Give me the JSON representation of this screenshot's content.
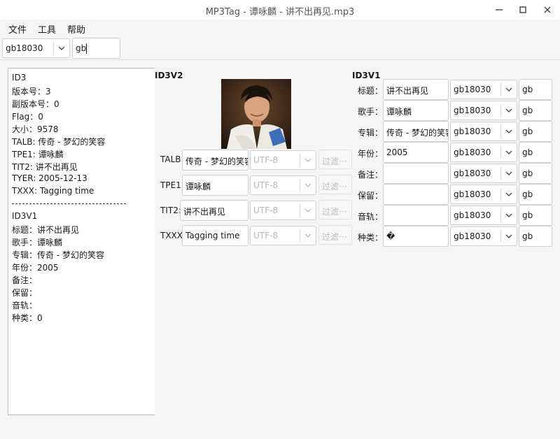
{
  "window": {
    "title": "MP3Tag - 谭咏麟 - 讲不出再见.mp3"
  },
  "menu": [
    "文件",
    "工具",
    "帮助"
  ],
  "toolbar": {
    "encoding": "gb18030",
    "filter": "gb"
  },
  "info": {
    "lines_top": [
      "ID3",
      "版本号：3",
      "副版本号：0",
      "Flag：0",
      "大小：9578",
      "TALB: 传奇 - 梦幻的笑容",
      "TPE1: 谭咏麟",
      "TIT2: 讲不出再见",
      "TYER: 2005-12-13",
      "TXXX: Tagging time"
    ],
    "separator": "----------------------------------------",
    "lines_bottom": [
      "ID3V1",
      "标题：讲不出再见",
      "歌手：谭咏麟",
      "专辑：传奇 - 梦幻的笑容",
      "年份：2005",
      "备注：",
      "保留：",
      "音轨：",
      "种类：0"
    ]
  },
  "id3v2": {
    "title": "ID3V2",
    "rows": [
      {
        "label": "TALB:",
        "value": "传奇 - 梦幻的笑容",
        "encoding": "UTF-8",
        "filter": "过滤···"
      },
      {
        "label": "TPE1:",
        "value": "谭咏麟",
        "encoding": "UTF-8",
        "filter": "过滤···"
      },
      {
        "label": "TIT2:",
        "value": "讲不出再见",
        "encoding": "UTF-8",
        "filter": "过滤···"
      },
      {
        "label": "TXXX:",
        "value": "Tagging time",
        "encoding": "UTF-8",
        "filter": "过滤···"
      }
    ]
  },
  "id3v1": {
    "title": "ID3V1",
    "rows": [
      {
        "label": "标题：",
        "value": "讲不出再见",
        "encoding": "gb18030",
        "filter": "gb"
      },
      {
        "label": "歌手：",
        "value": "谭咏麟",
        "encoding": "gb18030",
        "filter": "gb"
      },
      {
        "label": "专辑：",
        "value": "传奇 - 梦幻的笑容",
        "encoding": "gb18030",
        "filter": "gb"
      },
      {
        "label": "年份：",
        "value": "2005",
        "encoding": "gb18030",
        "filter": "gb"
      },
      {
        "label": "备注：",
        "value": "",
        "encoding": "gb18030",
        "filter": "gb"
      },
      {
        "label": "保留：",
        "value": "",
        "encoding": "gb18030",
        "filter": "gb"
      },
      {
        "label": "音轨：",
        "value": "",
        "encoding": "gb18030",
        "filter": "gb"
      },
      {
        "label": "种类：",
        "value": "�",
        "encoding": "gb18030",
        "filter": "gb"
      }
    ]
  }
}
